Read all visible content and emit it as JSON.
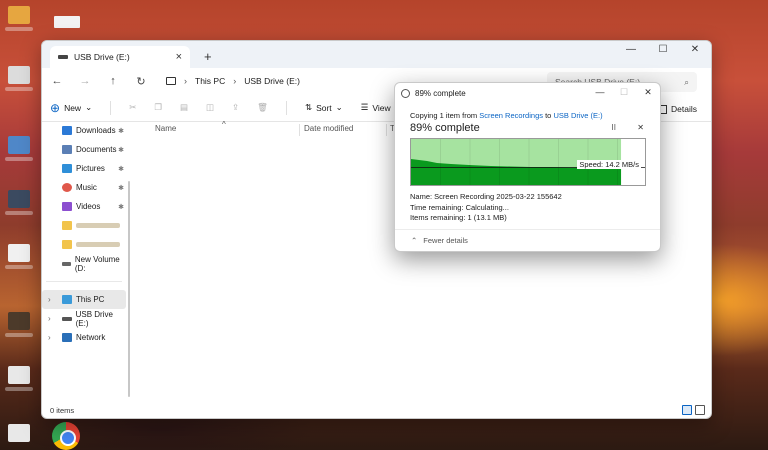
{
  "explorer": {
    "tab_title": "USB Drive (E:)",
    "tab_close": "×",
    "new_tab": "+",
    "window_controls": {
      "minimize": "—",
      "maximize": "☐",
      "close": "✕"
    },
    "nav": {
      "back": "←",
      "forward": "→",
      "up": "↑",
      "refresh": "↻"
    },
    "breadcrumb": [
      "This PC",
      "USB Drive (E:)"
    ],
    "breadcrumb_sep": "›",
    "search_placeholder": "Search USB Drive (E:)",
    "search_icon": "⌕",
    "toolbar": {
      "new_label": "New",
      "sort_label": "Sort",
      "view_label": "View",
      "details_label": "Details",
      "dropdown": "⌄"
    },
    "sidebar": {
      "quick": [
        {
          "label": "Downloads",
          "icon": "download-icon",
          "color": "#2b79d6"
        },
        {
          "label": "Documents",
          "icon": "documents-icon",
          "color": "#5b7fb5"
        },
        {
          "label": "Pictures",
          "icon": "pictures-icon",
          "color": "#2f8fd8"
        },
        {
          "label": "Music",
          "icon": "music-icon",
          "color": "#e0584b"
        },
        {
          "label": "Videos",
          "icon": "videos-icon",
          "color": "#8c4fd0"
        }
      ],
      "new_volume": "New Volume (D:",
      "this_pc": "This PC",
      "usb_drive": "USB Drive (E:)",
      "network": "Network",
      "pin": "✱",
      "chevron": "›"
    },
    "columns": {
      "name": "Name",
      "date_modified": "Date modified",
      "type_initial": "T",
      "sort_caret": "^"
    },
    "status": "0 items"
  },
  "dialog": {
    "title": "89% complete",
    "controls": {
      "minimize": "—",
      "maximize": "☐",
      "close": "✕"
    },
    "copy_prefix": "Copying 1 item from ",
    "source": "Screen Recordings",
    "copy_mid": " to ",
    "destination": "USB Drive (E:)",
    "heading": "89% complete",
    "pause": "II",
    "cancel": "✕",
    "progress_percent": 89,
    "speed_label": "Speed: 14.2 MB/s",
    "name_line": "Name:  Screen Recording 2025-03-22 155642",
    "time_line": "Time remaining:  Calculating...",
    "items_line": "Items remaining:  1 (13.1 MB)",
    "fewer_details": "Fewer details",
    "fewer_chevron": "⌃",
    "colors": {
      "fill": "#a6e3a0",
      "throughput": "#0a9a1e"
    }
  }
}
